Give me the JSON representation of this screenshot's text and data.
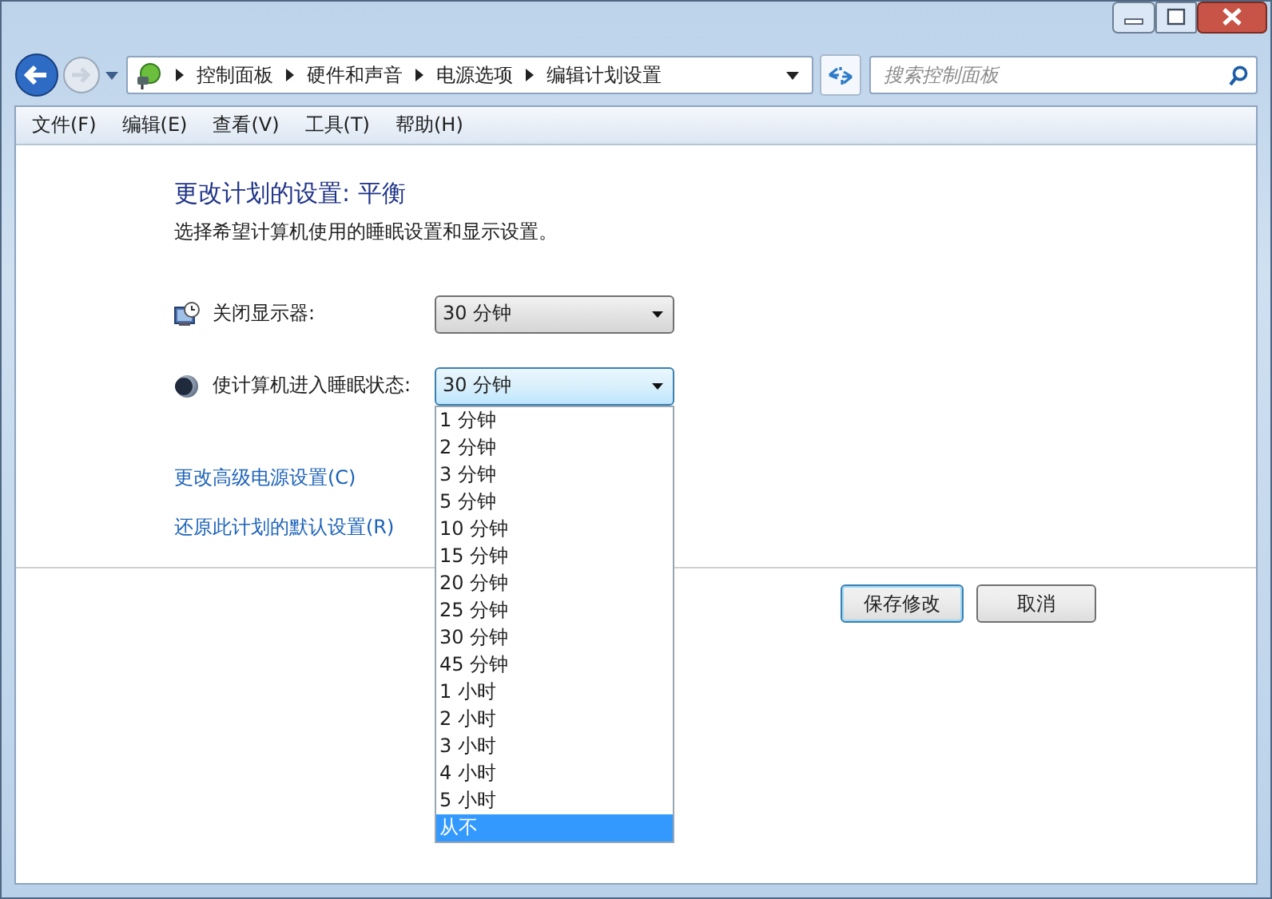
{
  "breadcrumb": [
    "控制面板",
    "硬件和声音",
    "电源选项",
    "编辑计划设置"
  ],
  "search": {
    "placeholder": "搜索控制面板"
  },
  "menu": [
    "文件(F)",
    "编辑(E)",
    "查看(V)",
    "工具(T)",
    "帮助(H)"
  ],
  "heading": "更改计划的设置: 平衡",
  "description": "选择希望计算机使用的睡眠设置和显示设置。",
  "settings": [
    {
      "kind": "display",
      "label": "关闭显示器:",
      "value": "30 分钟",
      "open": false
    },
    {
      "kind": "sleep",
      "label": "使计算机进入睡眠状态:",
      "value": "30 分钟",
      "open": true,
      "options": [
        {
          "label": "1 分钟",
          "highlighted": false
        },
        {
          "label": "2 分钟",
          "highlighted": false
        },
        {
          "label": "3 分钟",
          "highlighted": false
        },
        {
          "label": "5 分钟",
          "highlighted": false
        },
        {
          "label": "10 分钟",
          "highlighted": false
        },
        {
          "label": "15 分钟",
          "highlighted": false
        },
        {
          "label": "20 分钟",
          "highlighted": false
        },
        {
          "label": "25 分钟",
          "highlighted": false
        },
        {
          "label": "30 分钟",
          "highlighted": false
        },
        {
          "label": "45 分钟",
          "highlighted": false
        },
        {
          "label": "1 小时",
          "highlighted": false
        },
        {
          "label": "2 小时",
          "highlighted": false
        },
        {
          "label": "3 小时",
          "highlighted": false
        },
        {
          "label": "4 小时",
          "highlighted": false
        },
        {
          "label": "5 小时",
          "highlighted": false
        },
        {
          "label": "从不",
          "highlighted": true
        }
      ]
    }
  ],
  "links": [
    "更改高级电源设置(C)",
    "还原此计划的默认设置(R)"
  ],
  "buttons": [
    {
      "label": "保存修改",
      "default": true
    },
    {
      "label": "取消",
      "default": false
    }
  ]
}
